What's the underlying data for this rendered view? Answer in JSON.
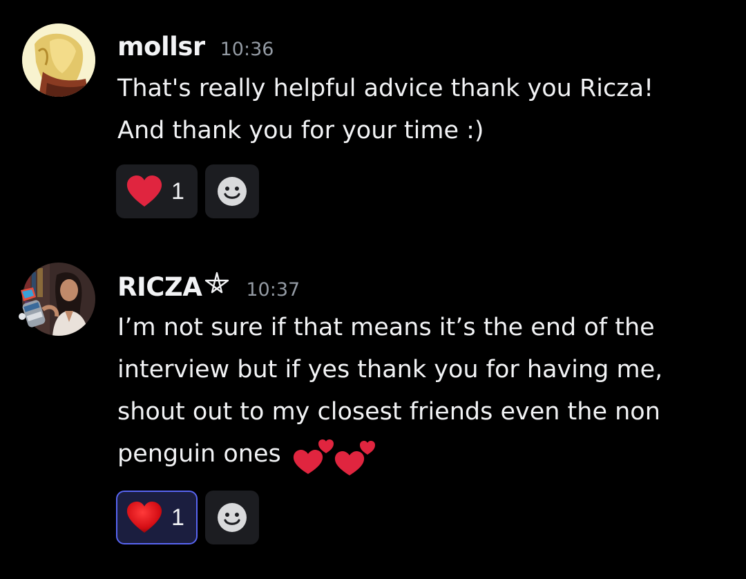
{
  "messages": [
    {
      "username": "mollsr",
      "timestamp": "10:36",
      "content": "That's really helpful advice thank you Ricza!\nAnd thank you for your time :)",
      "reactions": [
        {
          "emoji": "red-heart-icon",
          "count": "1",
          "reacted_by_me": false
        }
      ]
    },
    {
      "username": "RICZA",
      "timestamp": "10:37",
      "content": "I’m not sure if that means it’s the end of the\ninterview but if yes thank you for having me,\nshout out to my closest friends even the non\npenguin ones ",
      "reactions": [
        {
          "emoji": "red-heart-icon",
          "count": "1",
          "reacted_by_me": true
        }
      ]
    }
  ],
  "colors": {
    "background": "#000000",
    "text": "#f2f3f5",
    "timestamp": "#949ba4",
    "reaction_bg": "#1c1d21",
    "reaction_active_border": "#5865f2",
    "heart": "#e0253f"
  }
}
